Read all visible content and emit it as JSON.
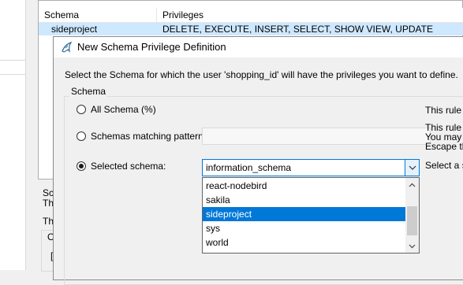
{
  "background": {
    "grid": {
      "headers": [
        "Schema",
        "Privileges"
      ],
      "rows": [
        {
          "schema": "sideproject",
          "privileges": "DELETE, EXECUTE, INSERT, SELECT, SHOW VIEW, UPDATE"
        }
      ]
    },
    "under_text": [
      "Sch",
      "The",
      "The"
    ],
    "under_box_label": "O",
    "under_box_inner": "["
  },
  "dialog": {
    "title": "New Schema Privilege Definition",
    "instruction": "Select the Schema for which the user 'shopping_id' will have the privileges you want to define.",
    "group_label": "Schema",
    "options": {
      "all": {
        "label": "All Schema (%)",
        "note": "This rule w"
      },
      "pattern": {
        "label": "Schemas matching pattern:",
        "value": "",
        "note_lines": [
          "This rule w",
          "You may u",
          "Escape th"
        ]
      },
      "selected": {
        "label": "Selected schema:",
        "value": "information_schema",
        "note": "Select a sp"
      }
    },
    "selected_option": "selected",
    "dropdown_items": [
      "react-nodebird",
      "sakila",
      "sideproject",
      "sys",
      "world"
    ],
    "dropdown_highlighted": "sideproject"
  },
  "colors": {
    "accent": "#0078d7",
    "selected_row": "#cde8ff",
    "window_bg": "#f0f0f0"
  },
  "icons": {
    "app": "mysql-workbench-dolphin-icon",
    "combo": "chevron-down-icon",
    "scroll_up": "chevron-up-icon",
    "scroll_down": "chevron-down-icon"
  }
}
